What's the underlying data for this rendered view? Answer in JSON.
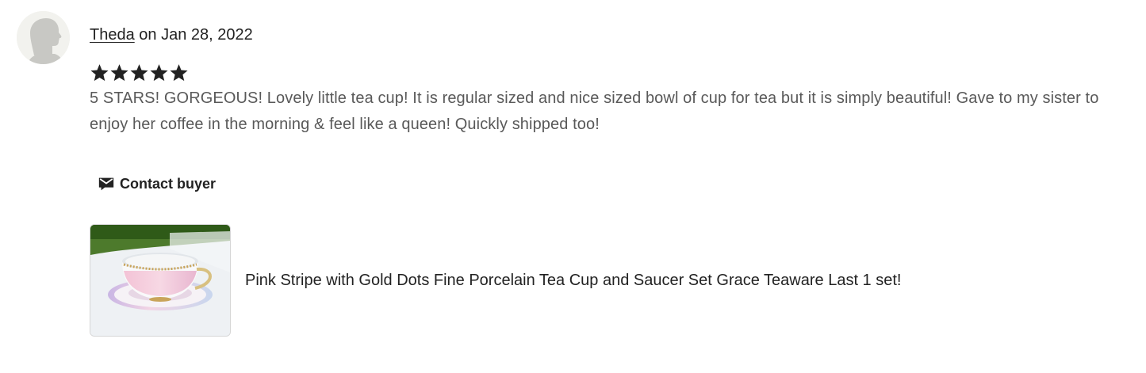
{
  "review": {
    "author": "Theda",
    "date_text": " on Jan 28, 2022",
    "rating": 5,
    "rating_max": 5,
    "star_icon": "star-icon",
    "body": "5 STARS! GORGEOUS! Lovely little tea cup! It is regular sized and nice sized bowl of cup for tea but it is simply beautiful! Gave to my sister to enjoy her coffee in the morning & feel like a queen! Quickly shipped too!"
  },
  "contact": {
    "label": "Contact buyer",
    "icon": "mail-icon"
  },
  "product": {
    "title": "Pink Stripe with Gold Dots Fine Porcelain Tea Cup and Saucer Set Grace Teaware Last 1 set!"
  },
  "colors": {
    "text": "#222222",
    "body_text": "#595959",
    "avatar_bg": "#f2f2ee",
    "avatar_fg": "#c8c8c4"
  }
}
